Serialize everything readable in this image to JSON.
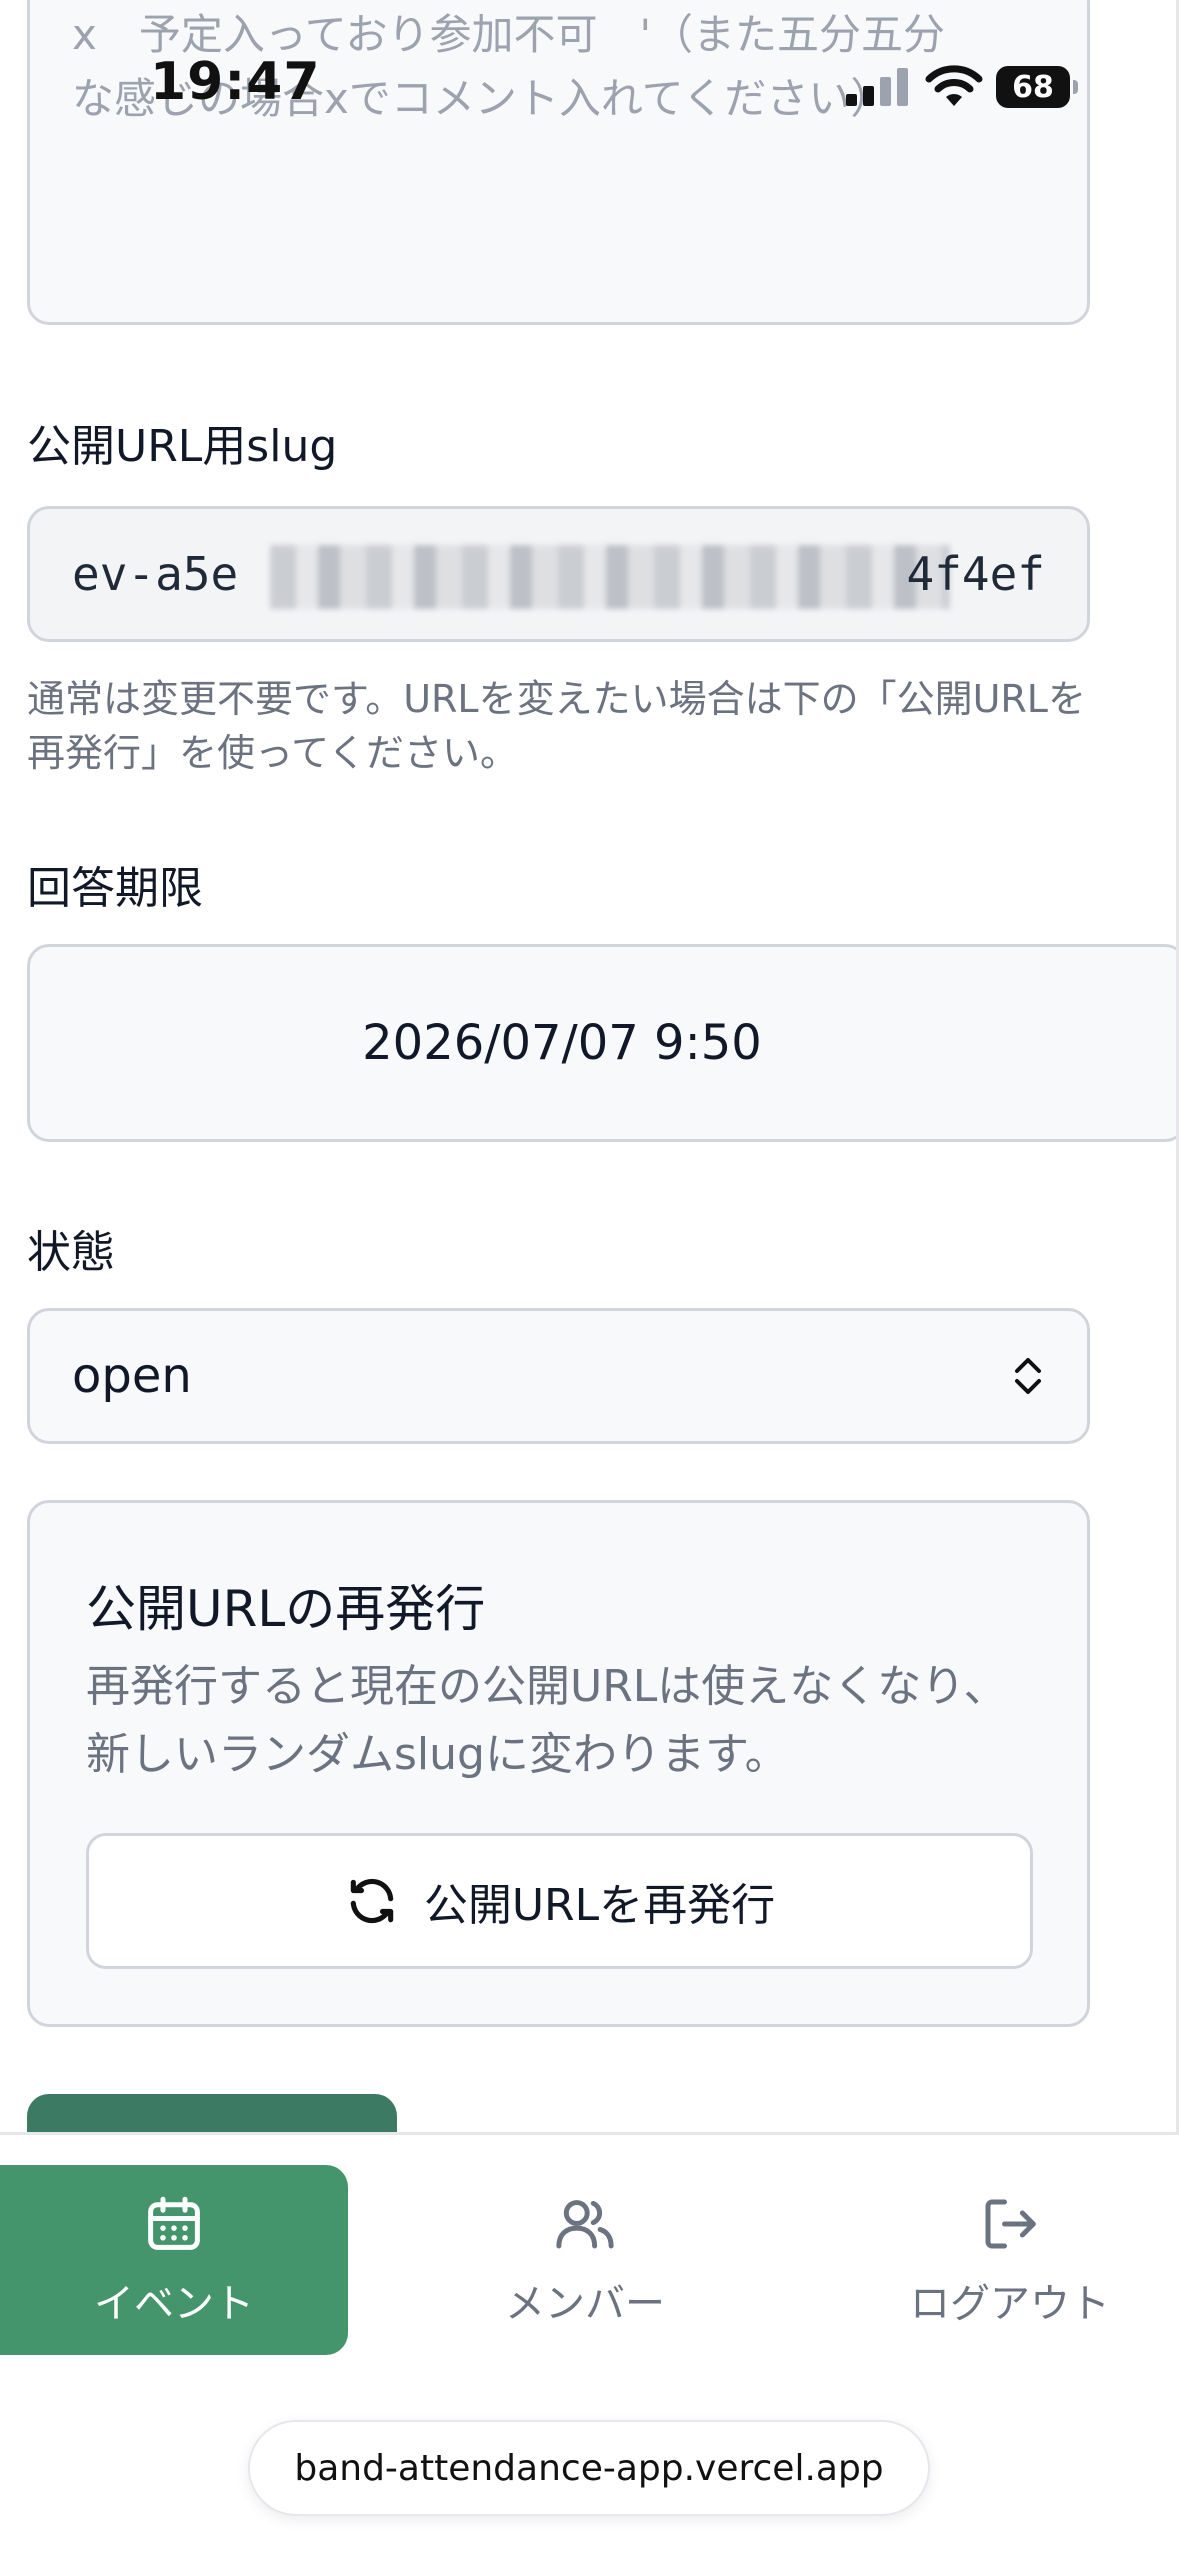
{
  "status_bar": {
    "time": "19:47",
    "battery": "68"
  },
  "comment_field": {
    "placeholder": "x　予定入っており参加不可　'（また五分五分\nな感じの場合xでコメント入れてください）"
  },
  "slug": {
    "label": "公開URL用slug",
    "value": "ev-a5e",
    "value_end": "4f4ef",
    "helper": "通常は変更不要です。URLを変えたい場合は下の「公開URLを再発行」を使ってください。"
  },
  "deadline": {
    "label": "回答期限",
    "value": "2026/07/07 9:50"
  },
  "status": {
    "label": "状態",
    "value": "open"
  },
  "reissue": {
    "title": "公開URLの再発行",
    "description": "再発行すると現在の公開URLは使えなくなり、新しいランダムslugに変わります。",
    "button_label": "公開URLを再発行"
  },
  "bottom_nav": {
    "items": [
      {
        "label": "イベント",
        "icon": "calendar-icon",
        "active": true
      },
      {
        "label": "メンバー",
        "icon": "users-icon",
        "active": false
      },
      {
        "label": "ログアウト",
        "icon": "logout-icon",
        "active": false
      }
    ]
  },
  "browser": {
    "url": "band-attendance-app.vercel.app"
  },
  "colors": {
    "accent": "#44956c",
    "submit": "#3c7a63",
    "border": "#d1d5db",
    "muted_text": "#6b7280"
  }
}
